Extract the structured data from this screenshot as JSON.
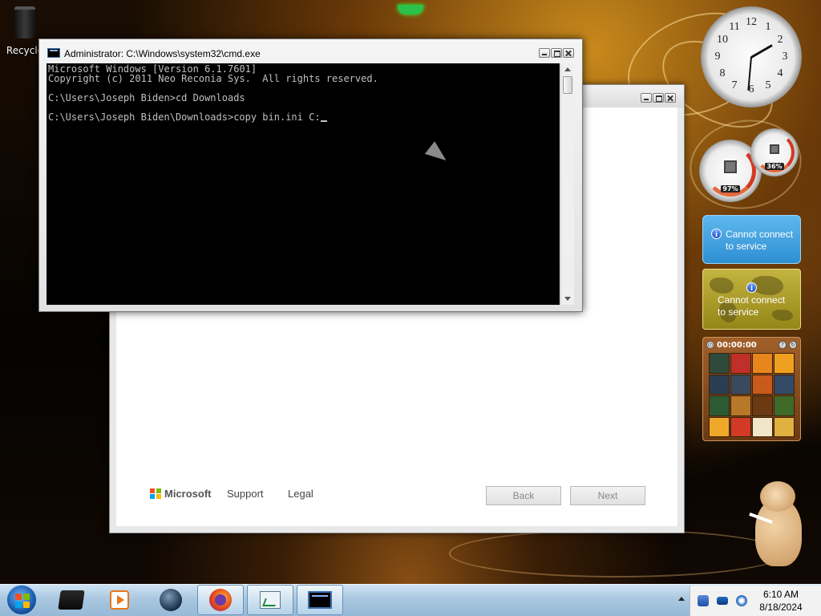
{
  "desktop": {
    "icons": [
      {
        "label": "Recycle",
        "icon": "recycle-bin-icon"
      }
    ]
  },
  "setup_window": {
    "footer": {
      "brand": "Microsoft",
      "support_label": "Support",
      "legal_label": "Legal",
      "back_label": "Back",
      "next_label": "Next"
    }
  },
  "cmd_window": {
    "title": "Administrator: C:\\Windows\\system32\\cmd.exe",
    "lines": [
      "Microsoft Windows [Version 6.1.7601]",
      "Copyright (c) 2011 Neo Reconia Sys.  All rights reserved.",
      "",
      "C:\\Users\\Joseph Biden>cd Downloads",
      "",
      "C:\\Users\\Joseph Biden\\Downloads>copy bin.ini C:"
    ]
  },
  "gadgets": {
    "clock": {
      "numbers": [
        "12",
        "1",
        "2",
        "3",
        "4",
        "5",
        "6",
        "7",
        "8",
        "9",
        "10",
        "11"
      ]
    },
    "cpu_meter": {
      "cpu_value": "97%",
      "memory_value": "36%"
    },
    "weather": {
      "message": "Cannot connect to service",
      "icon": "info-icon"
    },
    "world_clock": {
      "message": "Cannot connect to service",
      "icon": "info-icon"
    },
    "puzzle": {
      "timer": "00:00:00"
    }
  },
  "taskbar": {
    "items": [
      {
        "name": "taskbar-item-drive",
        "icon": "drive-icon",
        "active": false
      },
      {
        "name": "taskbar-item-media-player",
        "icon": "media-player-icon",
        "active": false
      },
      {
        "name": "taskbar-item-globe",
        "icon": "globe-icon",
        "active": false
      },
      {
        "name": "taskbar-item-firefox",
        "icon": "firefox-icon",
        "active": true
      },
      {
        "name": "taskbar-item-chart-app",
        "icon": "chart-app-icon",
        "active": true
      },
      {
        "name": "taskbar-item-cmd",
        "icon": "cmd-icon",
        "active": true
      }
    ],
    "clock_time": "6:10 AM",
    "clock_date": "8/18/2024"
  },
  "colors": {
    "console_bg": "#000000",
    "console_text": "#c0c0c0",
    "taskbar": "#a9c7e0",
    "weather_gadget": "#2d8fd2",
    "world_clock_gadget": "#948617"
  }
}
